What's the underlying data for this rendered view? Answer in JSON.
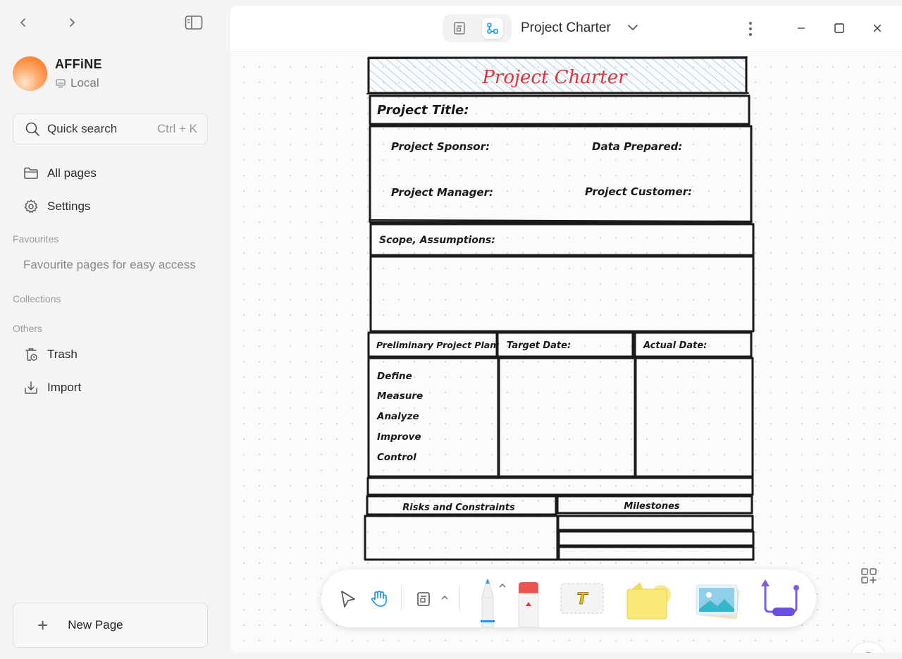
{
  "sidebar": {
    "workspace": {
      "name": "AFFiNE",
      "storage": "Local"
    },
    "search": {
      "label": "Quick search",
      "shortcut": "Ctrl + K"
    },
    "items": [
      {
        "label": "All pages",
        "icon": "folder-icon"
      },
      {
        "label": "Settings",
        "icon": "gear-icon"
      }
    ],
    "favourites": {
      "heading": "Favourites",
      "empty": "Favourite pages for easy access"
    },
    "collections": {
      "heading": "Collections"
    },
    "others": {
      "heading": "Others",
      "items": [
        {
          "label": "Trash",
          "icon": "trash-icon"
        },
        {
          "label": "Import",
          "icon": "import-icon"
        }
      ]
    },
    "new_page": "New Page"
  },
  "header": {
    "title": "Project Charter",
    "modes": [
      "page-mode-icon",
      "edgeless-mode-icon"
    ],
    "active_mode": "edgeless"
  },
  "charter": {
    "heading": "Project Charter",
    "project_title": "Project Title:",
    "sponsor": "Project Sponsor:",
    "data_prepared": "Data Prepared:",
    "manager": "Project Manager:",
    "customer": "Project Customer:",
    "scope": "Scope, Assumptions:",
    "plan": "Preliminary Project Plan:",
    "target_date": "Target Date:",
    "actual_date": "Actual Date:",
    "steps": [
      "Define",
      "Measure",
      "Analyze",
      "Improve",
      "Control"
    ],
    "risks": "Risks and Constraints",
    "milestones": "Milestones",
    "accent_color": "#e0323b",
    "hatch_color": "#a8d4ef"
  },
  "toolbar": {
    "tools": [
      "select-icon",
      "hand-icon",
      "frame-icon",
      "pen-icon",
      "eraser-icon",
      "text-icon",
      "note-icon",
      "image-icon",
      "connector-icon"
    ],
    "active_tool": "hand-icon",
    "accent_color": "#1e96eb"
  }
}
